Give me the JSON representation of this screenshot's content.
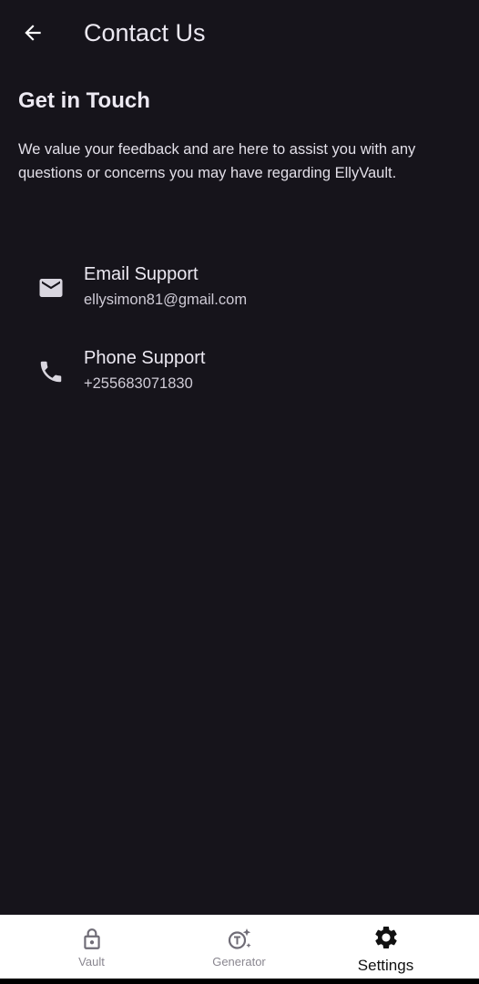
{
  "app_bar": {
    "title": "Contact Us",
    "back_icon": "arrow-left-icon"
  },
  "content": {
    "heading": "Get in Touch",
    "description": "We value your feedback and are here to assist you with any questions or concerns you may have regarding EllyVault."
  },
  "contacts": [
    {
      "icon": "mail-icon",
      "title": "Email Support",
      "value": "ellysimon81@gmail.com"
    },
    {
      "icon": "phone-icon",
      "title": "Phone Support",
      "value": "+255683071830"
    }
  ],
  "bottom_nav": {
    "items": [
      {
        "label": "Vault",
        "icon": "lock-icon",
        "active": false
      },
      {
        "label": "Generator",
        "icon": "generator-icon",
        "active": false
      },
      {
        "label": "Settings",
        "icon": "gear-icon",
        "active": true
      }
    ]
  },
  "colors": {
    "background": "#16141b",
    "text_primary": "#ece9f2",
    "text_secondary": "#cfcbd6",
    "nav_background": "#ffffff",
    "nav_inactive": "#8a8790",
    "nav_active": "#111111"
  }
}
